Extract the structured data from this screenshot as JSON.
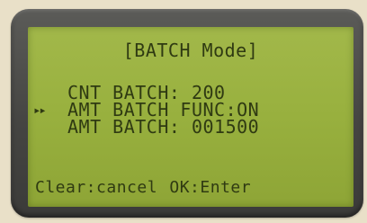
{
  "display": {
    "title": "[BATCH Mode]",
    "cursor_glyph": "▸▸",
    "menu": [
      {
        "label": "CNT BATCH: 200"
      },
      {
        "label": "AMT BATCH FUNC:ON"
      },
      {
        "label": "AMT BATCH: 001500"
      }
    ],
    "footer": "Clear:cancel OK:Enter"
  },
  "colors": {
    "bezel": "#454542",
    "lcd_background": "#99b13f",
    "lcd_text": "#2f3a12",
    "surround": "#e9e0c8"
  }
}
